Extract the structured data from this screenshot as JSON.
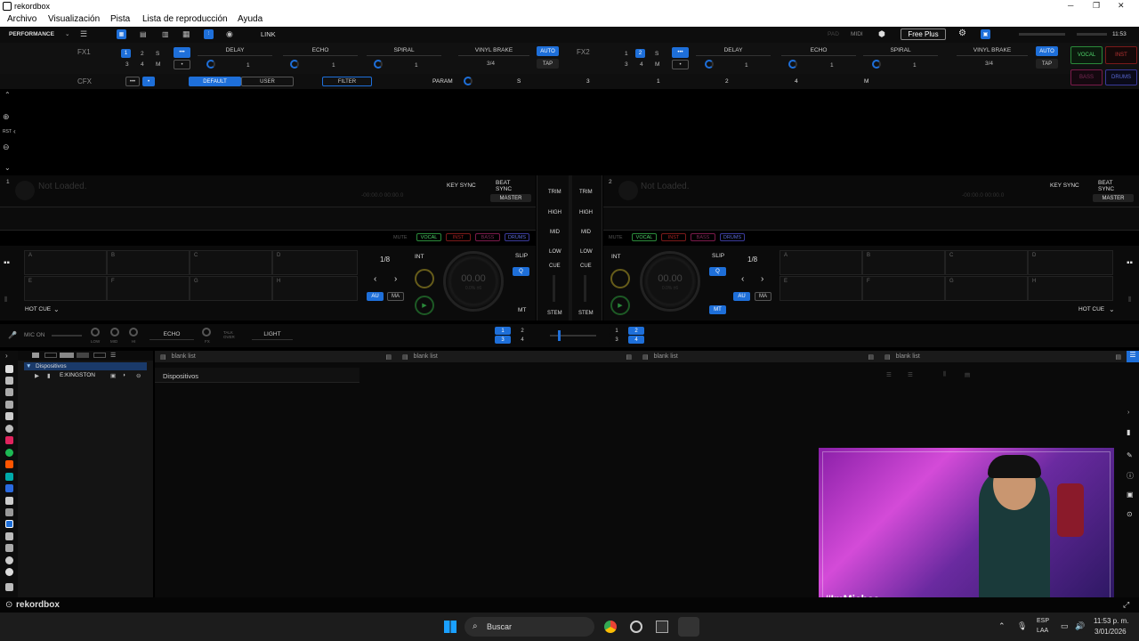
{
  "window": {
    "title": "rekordbox",
    "min": "─",
    "max": "❐",
    "close": "✕"
  },
  "menu": [
    "Archivo",
    "Visualización",
    "Pista",
    "Lista de reproducción",
    "Ayuda"
  ],
  "toolbar": {
    "mode": "PERFORMANCE",
    "link": "LINK",
    "pad": "PAD",
    "midi": "MIDI",
    "plan": "Free Plus",
    "clock": "11:53"
  },
  "fx1": {
    "label": "FX1",
    "beats": [
      "1",
      "2",
      "S",
      "3",
      "4",
      "M"
    ],
    "more": "•••",
    "dot": "•",
    "units": [
      {
        "name": "DELAY",
        "value": "1"
      },
      {
        "name": "ECHO",
        "value": "1"
      },
      {
        "name": "SPIRAL",
        "value": "1"
      }
    ],
    "brake": "VINYL BRAKE",
    "brake_value": "3/4",
    "auto": "AUTO",
    "tap": "TAP"
  },
  "fx2": {
    "label": "FX2",
    "beats": [
      "1",
      "2",
      "S",
      "3",
      "4",
      "M"
    ],
    "more": "•••",
    "dot": "•",
    "units": [
      {
        "name": "DELAY",
        "value": "1"
      },
      {
        "name": "ECHO",
        "value": "1"
      },
      {
        "name": "SPIRAL",
        "value": "1"
      }
    ],
    "brake": "VINYL BRAKE",
    "brake_value": "3/4",
    "auto": "AUTO",
    "tap": "TAP"
  },
  "stems_buttons": {
    "vocal": "VOCAL",
    "inst": "INST",
    "bass": "BASS",
    "drums": "DRUMS"
  },
  "cfx": {
    "label": "CFX",
    "more": "•••",
    "dot": "•",
    "default": "DEFAULT",
    "user": "USER",
    "filter": "FILTER",
    "param": "PARAM",
    "params": [
      "S",
      "3",
      "1",
      "2",
      "4",
      "M"
    ]
  },
  "waveform": {
    "rst": "RST"
  },
  "deck1": {
    "number": "1",
    "status": "Not Loaded.",
    "time": "-00:00.0  00:00.0",
    "key_sync": "KEY SYNC",
    "beat_sync": "BEAT SYNC",
    "master": "MASTER",
    "mute": "MUTE",
    "pads": [
      "A",
      "B",
      "C",
      "D",
      "E",
      "F",
      "G",
      "H"
    ],
    "hot_cue": "HOT CUE",
    "loop": "1/8",
    "int": "INT",
    "slip": "SLIP",
    "q": "Q",
    "au": "AU",
    "ma": "MA",
    "mt": "MT",
    "jog_time": "00.00",
    "jog_sub": "0.0% ±6"
  },
  "deck2": {
    "number": "2",
    "status": "Not Loaded.",
    "time": "-00:00.0  00:00.0",
    "key_sync": "KEY SYNC",
    "beat_sync": "BEAT SYNC",
    "master": "MASTER",
    "mute": "MUTE",
    "pads": [
      "A",
      "B",
      "C",
      "D",
      "E",
      "F",
      "G",
      "H"
    ],
    "hot_cue": "HOT CUE",
    "loop": "1/8",
    "int": "INT",
    "slip": "SLIP",
    "q": "Q",
    "au": "AU",
    "ma": "MA",
    "mt": "MT",
    "jog_time": "00.00",
    "jog_sub": "0.0% ±6"
  },
  "mixer": {
    "trim": "TRIM",
    "high": "HIGH",
    "mid": "MID",
    "low": "LOW",
    "cue": "CUE",
    "stem": "STEM"
  },
  "mic": {
    "label": "MIC ON",
    "low": "LOW",
    "mid": "MID",
    "hi": "HI",
    "fx": "ECHO",
    "fx_lbl": "FX",
    "talkover": "TALK OVER",
    "light": "LIGHT"
  },
  "deckselect": {
    "left": [
      "1",
      "2",
      "3",
      "4"
    ],
    "right": [
      "1",
      "2",
      "3",
      "4"
    ]
  },
  "browser": {
    "tree_root": "Dispositivos",
    "tree_item": "E:KINGSTON",
    "tabs": [
      "blank list",
      "blank list",
      "blank list",
      "blank list"
    ],
    "header": "Dispositivos"
  },
  "overlay": {
    "handle": "#ImMichaa"
  },
  "footer": {
    "brand": "rekordbox"
  },
  "taskbar": {
    "search": "Buscar",
    "lang1": "ESP",
    "lang2": "LAA",
    "time": "11:53 p. m.",
    "date": "3/01/2026"
  }
}
